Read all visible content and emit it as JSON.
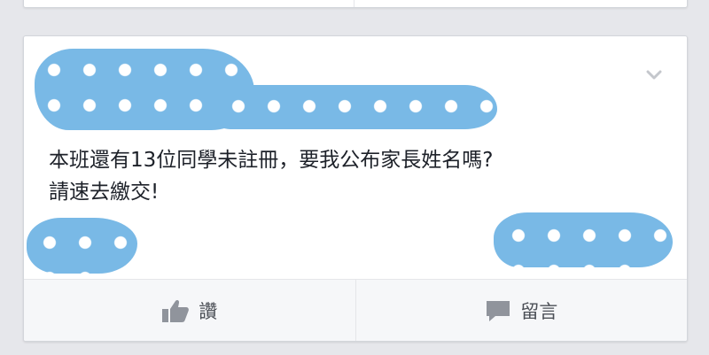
{
  "post": {
    "text_lines": [
      "本班還有13位同學未註冊，要我公布家長姓名嗎?",
      "請速去繳交!"
    ],
    "menu_icon": "chevron-down-icon"
  },
  "actions": {
    "like": {
      "label": "讚",
      "icon": "thumbs-up-icon"
    },
    "comment": {
      "label": "留言",
      "icon": "comment-icon"
    }
  },
  "colors": {
    "background": "#e6e7eb",
    "card": "#ffffff",
    "redaction_fill": "#79b9e6",
    "text": "#1d2129",
    "action_text": "#4b4f56",
    "icon_gray": "#90949c"
  }
}
